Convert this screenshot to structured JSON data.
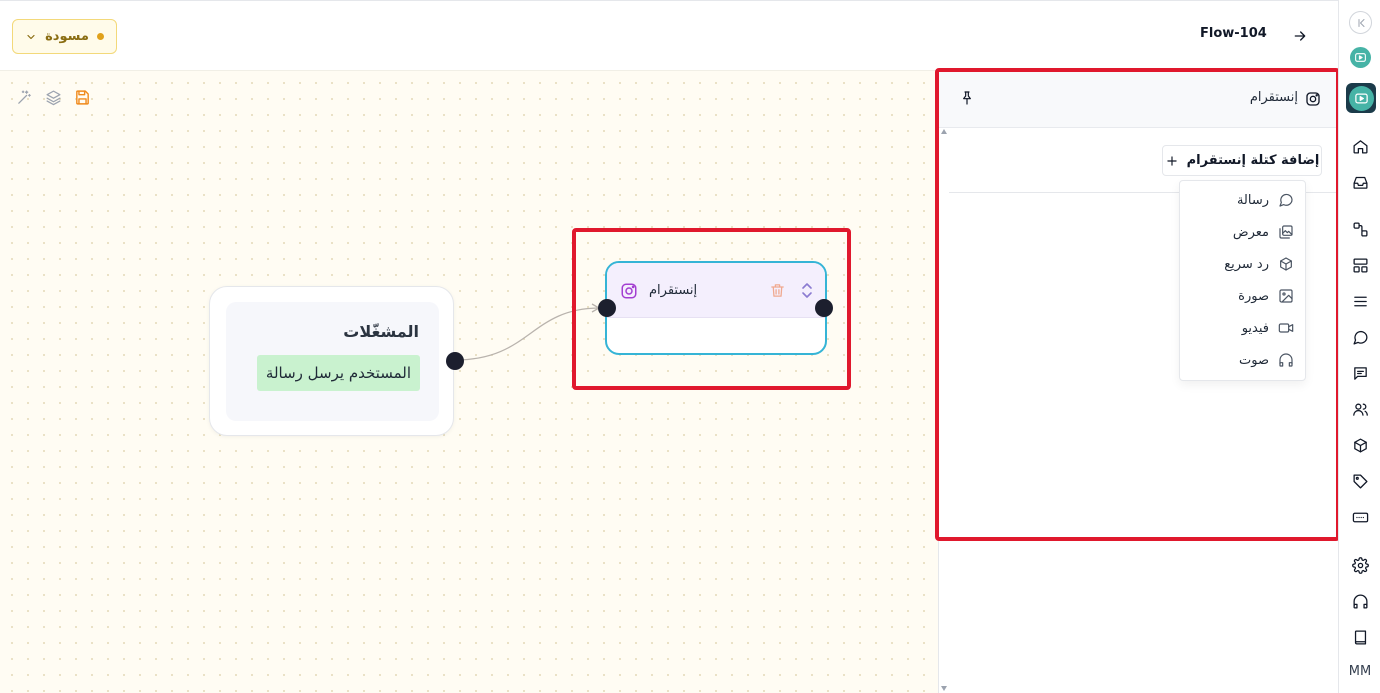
{
  "header": {
    "flow_title": "Flow-104",
    "status_label": "مسودة",
    "status_color": "#e0a11b"
  },
  "canvas": {
    "tools": [
      "magic-wand-icon",
      "layers-icon",
      "save-icon"
    ],
    "trigger_node": {
      "title": "المشغّلات",
      "trigger": "المستخدم يرسل رسالة"
    },
    "instagram_node": {
      "title": "إنستقرام",
      "accent_color": "#35b4d6"
    }
  },
  "panel": {
    "title": "إنستقرام",
    "add_block_label": "إضافة كتلة إنستقرام",
    "block_types": [
      {
        "label": "رسالة",
        "icon": "message-circle-icon"
      },
      {
        "label": "معرض",
        "icon": "gallery-icon"
      },
      {
        "label": "رد سريع",
        "icon": "package-icon"
      },
      {
        "label": "صورة",
        "icon": "image-icon"
      },
      {
        "label": "فيديو",
        "icon": "video-icon"
      },
      {
        "label": "صوت",
        "icon": "headphones-icon"
      }
    ]
  },
  "rail": {
    "items": [
      "home-icon",
      "inbox-icon",
      "flows-icon",
      "layout-icon",
      "menu-icon",
      "chat-icon",
      "messages-icon",
      "users-icon",
      "box-icon",
      "tag-icon",
      "keyboard-icon",
      "settings-icon",
      "support-icon",
      "book-icon"
    ],
    "user_initials": "MM"
  },
  "highlight_color": "#e0182d"
}
